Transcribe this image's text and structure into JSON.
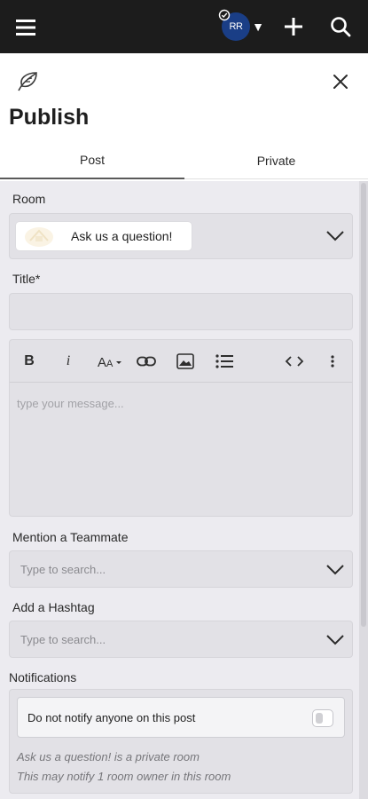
{
  "topbar": {
    "avatar_initials": "RR",
    "caret": "▼",
    "icons": [
      "menu-icon",
      "checkmark-badge-icon",
      "plus-icon",
      "search-icon"
    ]
  },
  "header": {
    "title": "Publish",
    "icons": [
      "leaf-icon",
      "close-icon"
    ],
    "tabs": [
      {
        "label": "Post",
        "active": true
      },
      {
        "label": "Private",
        "active": false
      }
    ]
  },
  "form": {
    "room": {
      "label": "Room",
      "selected": "Ask us a question!"
    },
    "title_field": {
      "label": "Title*",
      "value": ""
    },
    "editor": {
      "placeholder": "type your message...",
      "toolbar": [
        "bold-icon",
        "italic-icon",
        "text-size-icon",
        "link-icon",
        "image-icon",
        "bullet-list-icon",
        "code-icon",
        "more-vertical-icon"
      ]
    },
    "mention": {
      "label": "Mention a Teammate",
      "placeholder": "Type to search..."
    },
    "hashtag": {
      "label": "Add a Hashtag",
      "placeholder": "Type to search..."
    },
    "notifications": {
      "label": "Notifications",
      "toggle_label": "Do not notify anyone on this post",
      "toggle_on": false,
      "note_1": "Ask us a question! is a private room",
      "note_2": "This may notify 1 room owner in this room"
    }
  },
  "colors": {
    "topbar": "#1c1c1c",
    "avatar": "#1a3e86",
    "form_bg": "#ecebf0",
    "field_bg": "#e2e1e6"
  }
}
